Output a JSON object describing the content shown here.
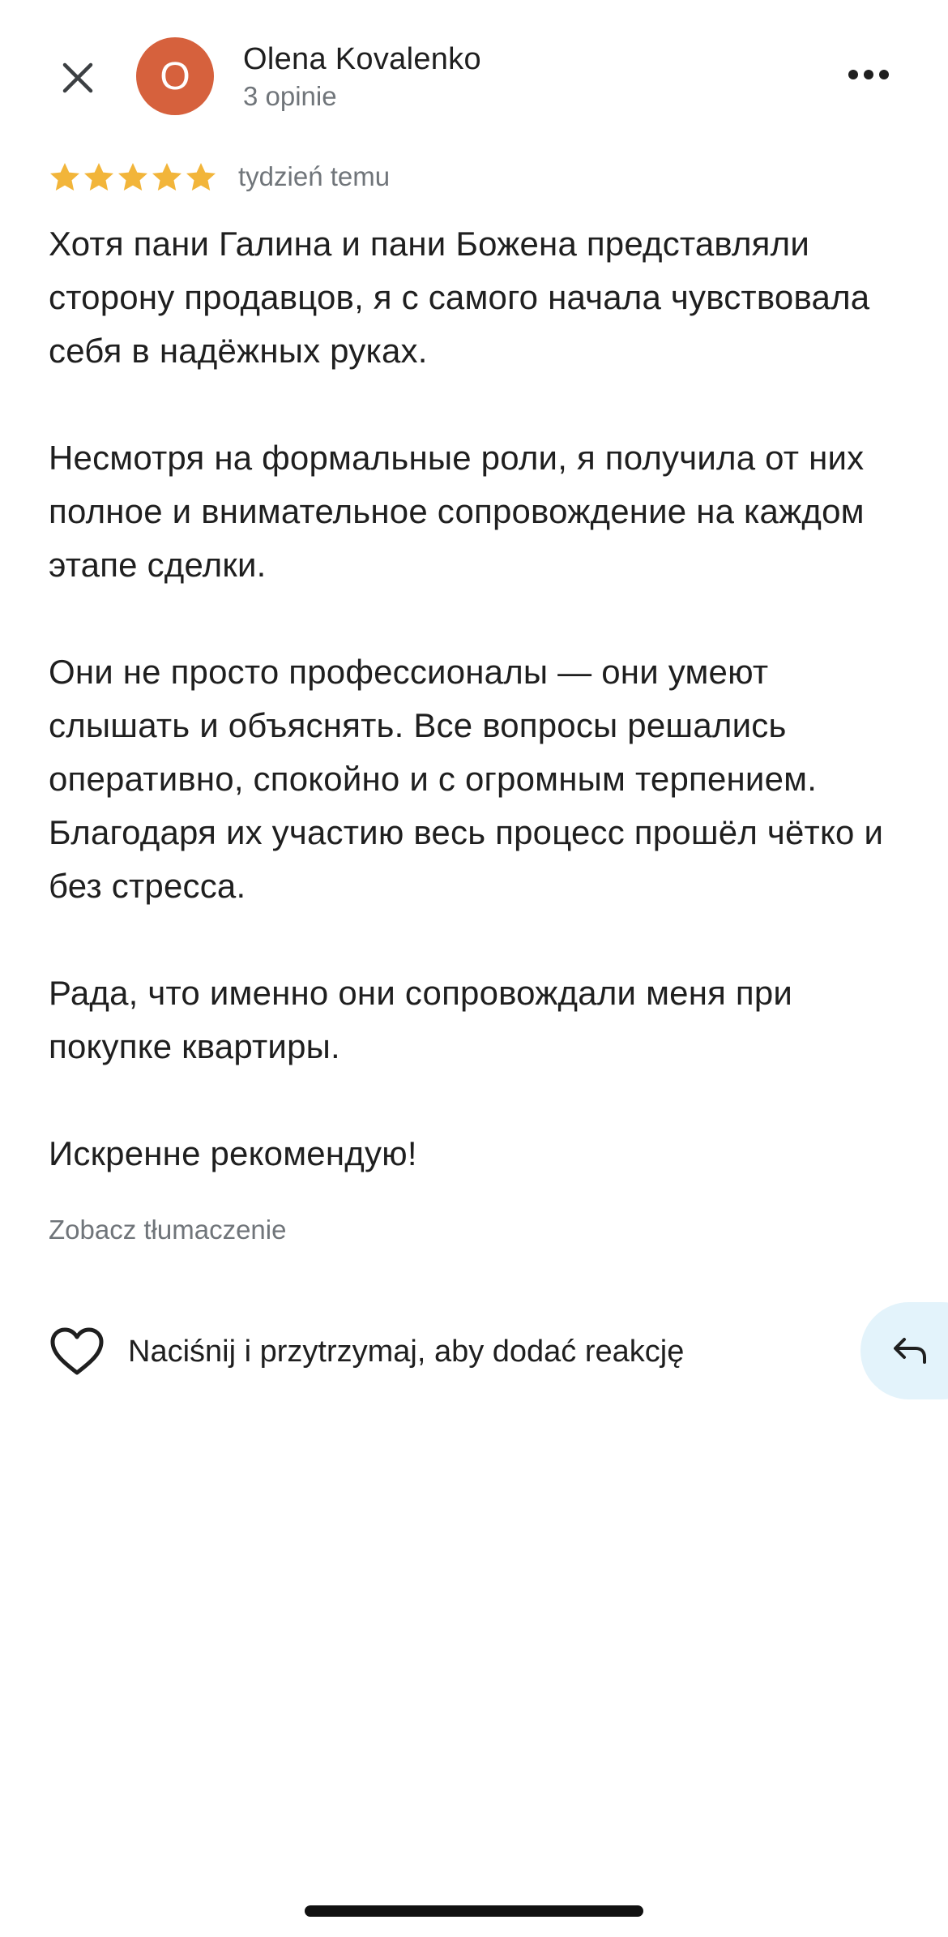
{
  "header": {
    "close_icon": "close-icon",
    "more_icon": "more-horizontal-icon"
  },
  "reviewer": {
    "avatar_letter": "O",
    "avatar_color": "#d6613d",
    "name": "Olena Kovalenko",
    "meta": "3 opinie"
  },
  "rating": {
    "value": 5,
    "max": 5,
    "star_color": "#f2b53a",
    "date": "tydzień temu"
  },
  "review": {
    "paragraphs": [
      "Хотя пани Галина и пани Божена представляли сторону продавцов, я с самого начала чувствовала себя в надёжных руках.",
      "Несмотря на формальные роли, я получила от них полное и  внимательное сопровождение на каждом этапе сделки.",
      "Они не просто профессионалы — они умеют слышать и объяснять. Все вопросы решались оперативно, спокойно и с огромным терпением. Благодаря их участию весь процесс прошёл чётко и без стресса.",
      "Рада, что именно они сопровождали меня при покупке квартиры.",
      "Искренне рекомендую!"
    ],
    "translate_link": "Zobacz tłumaczenie"
  },
  "reaction": {
    "icon": "heart-outline-icon",
    "label": "Naciśnij i przytrzymaj, aby dodać reakcję"
  },
  "reply": {
    "icon": "reply-arrow-icon",
    "bg_color": "#e3f3fb"
  }
}
